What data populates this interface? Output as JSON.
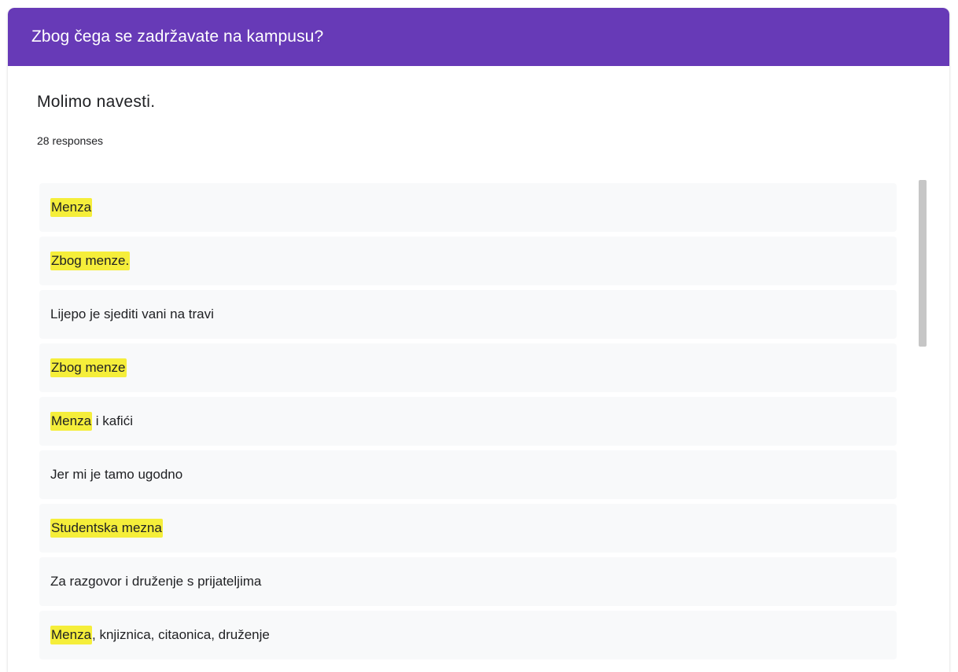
{
  "question": {
    "title": "Zbog čega se zadržavate na kampusu?",
    "description": "Molimo navesti.",
    "response_count": "28 responses"
  },
  "colors": {
    "header": "#673ab7",
    "highlight": "#f5ee3a",
    "response_bg": "#f8f9fa"
  },
  "responses": [
    {
      "highlighted": "Menza",
      "rest": ""
    },
    {
      "highlighted": "Zbog menze.",
      "rest": ""
    },
    {
      "highlighted": "",
      "rest": "Lijepo je sjediti vani na travi"
    },
    {
      "highlighted": "Zbog menze",
      "rest": ""
    },
    {
      "highlighted": "Menza",
      "rest": " i kafići"
    },
    {
      "highlighted": "",
      "rest": "Jer mi je tamo ugodno"
    },
    {
      "highlighted": "Studentska mezna",
      "rest": ""
    },
    {
      "highlighted": "",
      "rest": "Za razgovor i druženje s prijateljima"
    },
    {
      "highlighted": "Menza",
      "rest": ", knjiznica, citaonica, druženje"
    }
  ]
}
